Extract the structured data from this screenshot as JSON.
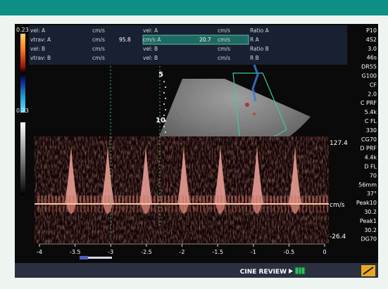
{
  "colors": {
    "accent_band": "#0e8f86",
    "frame": "#eef4f0",
    "spectral": "#e08a80",
    "baseline": "#ffc8a0",
    "status_bar": "#2a3040",
    "highlight_row": "#1d6a62",
    "trace_green": "#4fb86a"
  },
  "color_scale": {
    "top": "0.23",
    "bottom": "0.23"
  },
  "measurements": {
    "columns": [
      [
        {
          "label": "vel: A",
          "unit": "cm/s",
          "value": ""
        },
        {
          "label": "vtrav: A",
          "unit": "cm/s",
          "value": "95.8"
        },
        {
          "label": "vel: B",
          "unit": "cm/s",
          "value": ""
        },
        {
          "label": "vtrav: B",
          "unit": "cm/s",
          "value": ""
        }
      ],
      [
        {
          "label": "vel: A",
          "unit": "cm/s",
          "value": ""
        },
        {
          "label": "cm/s A",
          "unit": "cm/s",
          "value": "20.7"
        },
        {
          "label": "vel: B",
          "unit": "cm/s",
          "value": ""
        },
        {
          "label": "vel: B",
          "unit": "cm/s",
          "value": ""
        }
      ],
      [
        {
          "label": "Ratio A",
          "value": ""
        },
        {
          "label": "R A",
          "value": ""
        },
        {
          "label": "Ratio B",
          "value": ""
        },
        {
          "label": "R B",
          "value": ""
        }
      ]
    ]
  },
  "depth_markers": [
    "5",
    "10"
  ],
  "doppler": {
    "velocity_unit": "cm/s",
    "vmax_label": "127.4",
    "vmin_label": "-26.4",
    "time_ticks": [
      "-4",
      "-3.5",
      "-3",
      "-2.5",
      "-2",
      "-1.5",
      "-1",
      "-0.5",
      "0"
    ]
  },
  "params": [
    "P10",
    "4S2",
    "3.0",
    "46s",
    "DR55",
    "G100",
    "CF",
    "2.0",
    "C PRF",
    "5.4k",
    "C FL",
    "330",
    "CG70",
    "D PRF",
    "4.4k",
    "D FL",
    "70",
    "56mm",
    "37°",
    "Peak10",
    "30.2",
    "Peak1",
    "30.2",
    "DG70"
  ],
  "status_bar": {
    "cine_label": "CINE REVIEW"
  }
}
